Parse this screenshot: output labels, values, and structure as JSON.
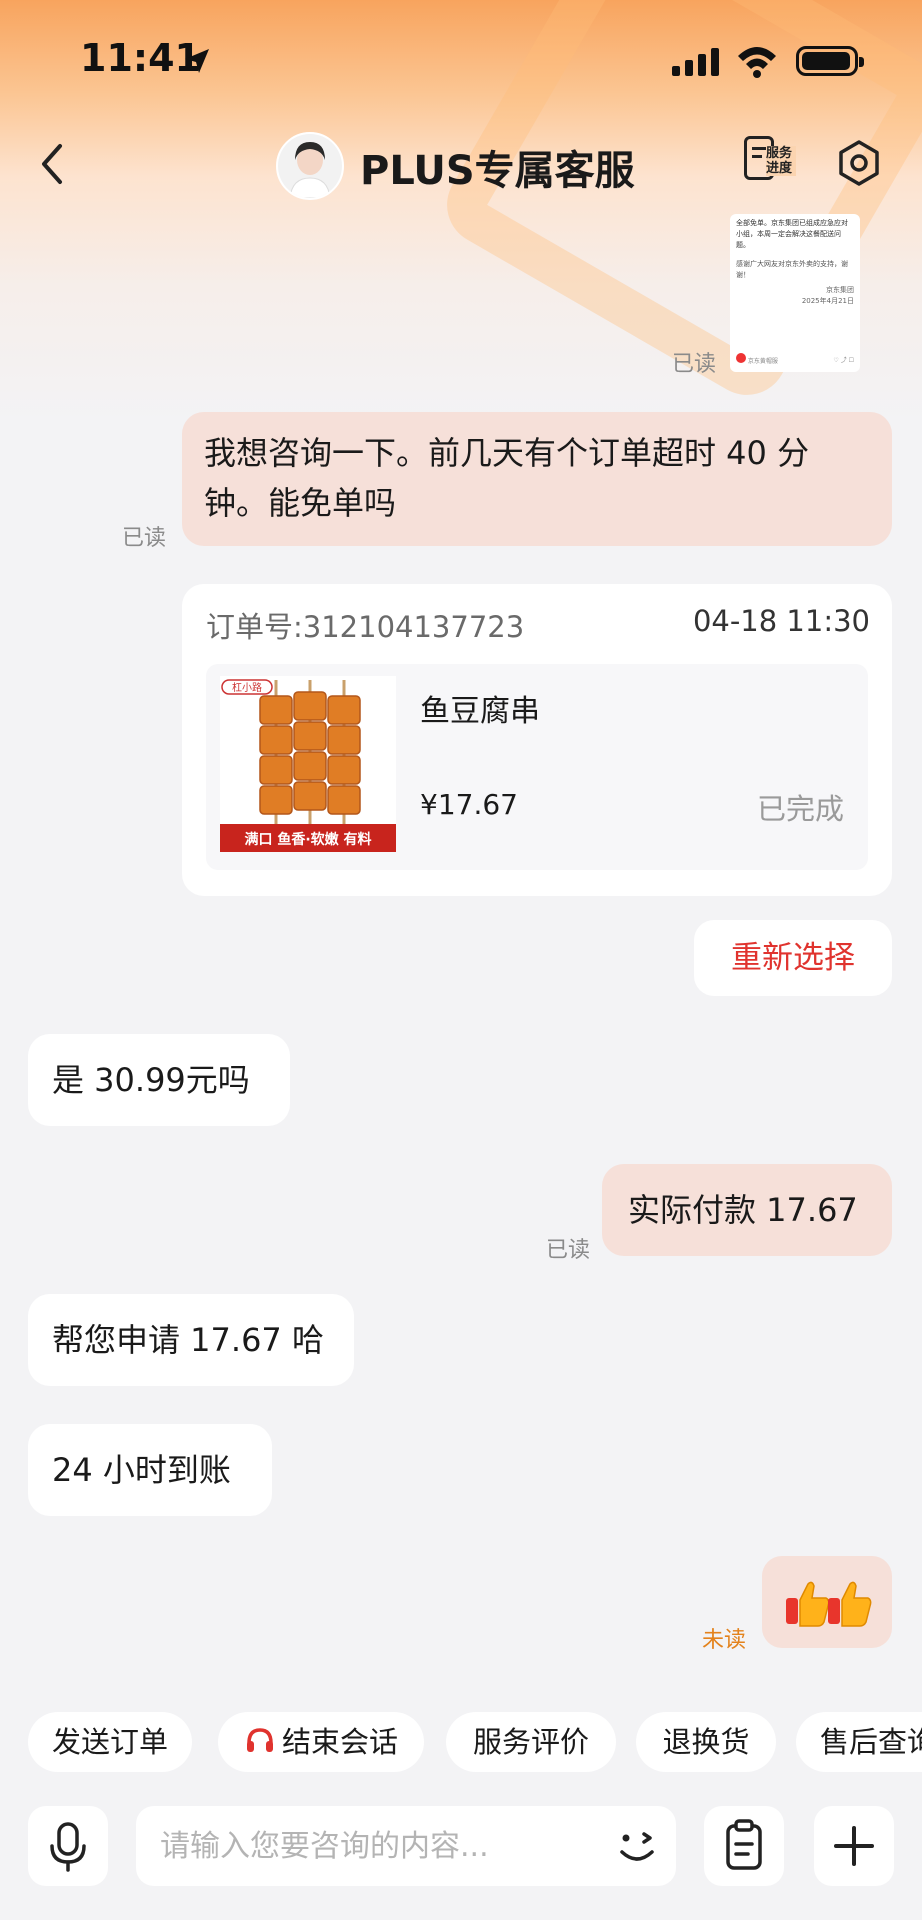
{
  "status_bar": {
    "time": "11:41"
  },
  "header": {
    "title": "PLUS专属客服",
    "progress_label": "服务进度"
  },
  "forwarded_post": {
    "text": "全部免单。京东集团已组成应急应对小组，本周一定会解决这餐配送问题。",
    "thanks": "感谢广大网友对京东外卖的支持，谢谢！",
    "signature": "京东集团",
    "date": "2025年4月21日",
    "account": "京东黄帽服"
  },
  "messages": [
    {
      "from": "me",
      "text": "我想咨询一下。前几天有个订单超时 40 分钟。能免单吗",
      "status": "已读"
    },
    {
      "from": "them",
      "text": "是 30.99元吗"
    },
    {
      "from": "me",
      "text": "实际付款 17.67",
      "status": "已读"
    },
    {
      "from": "them",
      "text": "帮您申请 17.67 哈"
    },
    {
      "from": "them",
      "text": "24 小时到账"
    },
    {
      "from": "me",
      "emoji": "thumbs-up x2",
      "status": "未读"
    }
  ],
  "read_labels": {
    "thumb": "已读",
    "msg1": "已读",
    "msg2": "已读",
    "emoji": "未读"
  },
  "order_card": {
    "order_no": "订单号:312104137723",
    "date": "04-18 11:30",
    "product_name": "鱼豆腐串",
    "price": "¥17.67",
    "status": "已完成",
    "img_text_top": "杠小路",
    "img_text_bottom": "满口 鱼香·软嫩 有料"
  },
  "reselect_label": "重新选择",
  "quick_actions": [
    "发送订单",
    "结束会话",
    "服务评价",
    "退换货",
    "售后查询"
  ],
  "input": {
    "placeholder": "请输入您要咨询的内容..."
  },
  "colors": {
    "accent": "#e0332e",
    "unread": "#e3821c",
    "my_bubble": "#f6e0d9"
  }
}
